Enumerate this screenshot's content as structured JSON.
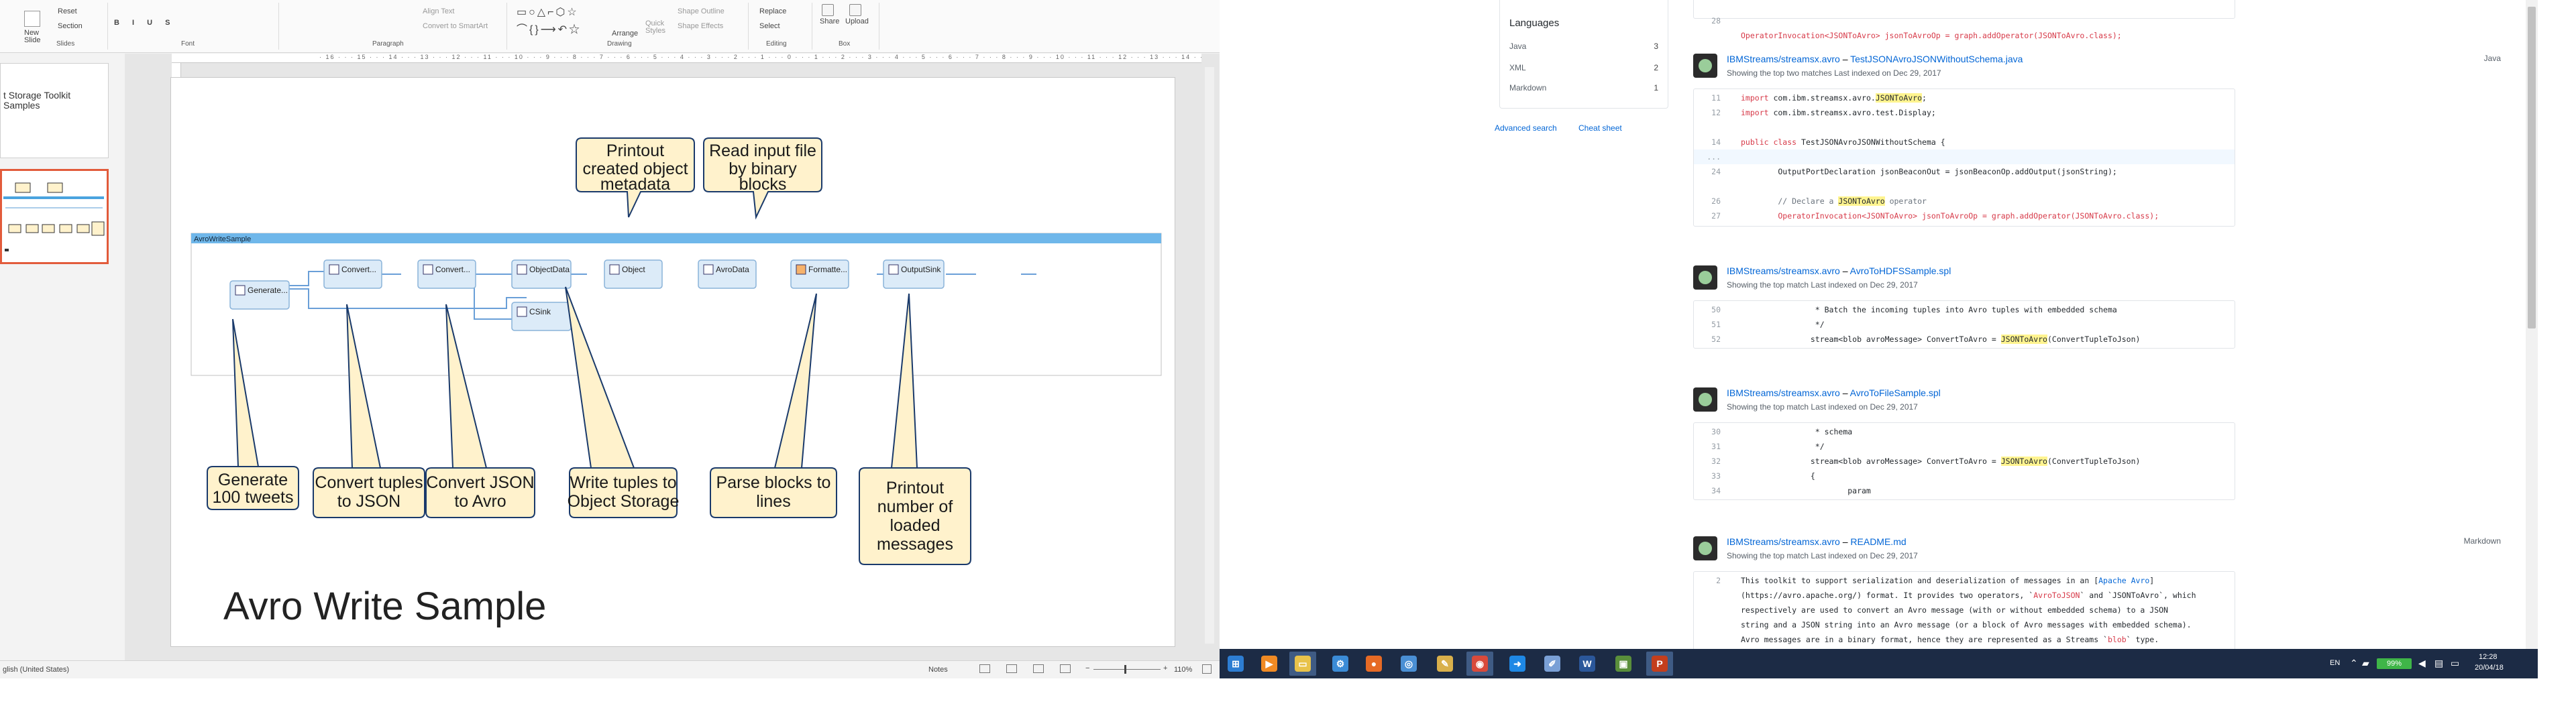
{
  "ppt": {
    "ribbon": {
      "new_slide": "New\nSlide",
      "reset": "Reset",
      "section": "Section",
      "align_text": "Align Text",
      "convert_smartart": "Convert to SmartArt",
      "arrange": "Arrange",
      "quick_styles": "Quick\nStyles",
      "shape_outline": "Shape Outline",
      "shape_effects": "Shape Effects",
      "replace": "Replace",
      "select": "Select",
      "share": "Share",
      "upload": "Upload",
      "group_slides": "Slides",
      "group_font": "Font",
      "group_paragraph": "Paragraph",
      "group_drawing": "Drawing",
      "group_editing": "Editing",
      "group_box": "Box"
    },
    "thumbnails": [
      {
        "text": "t Storage Toolkit\nSamples"
      }
    ],
    "ruler_text": "· 16 · · · 15 · · · 14 · · · 13 · · · 12 · · · 11 · · · 10 · · · 9 · · · 8 · · · 7 · · · 6 · · · 5 · · · 4 · · · 3 · · · 2 · · · 1 · · · 0 · · · 1 · · · 2 · · · 3 · · · 4 · · · 5 · · · 6 · · · 7 · · · 8 · · · 9 · · · 10 · · · 11 · · · 12 · · · 13 · · · 14 · · · 15 · · · 16 ·",
    "slide": {
      "title": "Avro Write Sample",
      "graph_header": "AvroWriteSample",
      "nodes": [
        "Generate...",
        "Convert...",
        "Convert...",
        "ObjectData",
        "Object",
        "AvroData",
        "Formatte...",
        "OutputSink",
        "CSink"
      ],
      "callouts": {
        "printout_metadata": [
          "Printout",
          "created object",
          "metadata"
        ],
        "read_input": [
          "Read input file",
          "by binary",
          "blocks"
        ],
        "generate": [
          "Generate",
          "100 tweets"
        ],
        "convert_json": [
          "Convert tuples",
          "to JSON"
        ],
        "convert_avro": [
          "Convert JSON",
          "to Avro"
        ],
        "write_tuples": [
          "Write tuples to",
          "Object Storage"
        ],
        "parse_blocks": [
          "Parse blocks to",
          "lines"
        ],
        "printout_count": [
          "Printout",
          "number of",
          "loaded",
          "messages"
        ]
      }
    },
    "status": {
      "language": "glish (United States)",
      "notes": "Notes",
      "zoom": "110%"
    }
  },
  "github": {
    "languages": {
      "heading": "Languages",
      "items": [
        {
          "name": "Java",
          "count": "3"
        },
        {
          "name": "XML",
          "count": "2"
        },
        {
          "name": "Markdown",
          "count": "1"
        }
      ]
    },
    "advanced_search": "Advanced search",
    "cheat_sheet": "Cheat sheet",
    "top_snippet": {
      "ln": "28",
      "pre": "OperatorInvocation<JSONToAvro> jsonToAvroOp = graph.addOperator(JSONToAvro.class);"
    },
    "results": [
      {
        "repo": "IBMStreams/streamsx.avro",
        "sep": " – ",
        "file": "TestJSONAvroJSONWithoutSchema.java",
        "meta": "Showing the top two matches    Last indexed on Dec 29, 2017",
        "lang": "Java",
        "lines": [
          {
            "ln": "11",
            "kw": "import",
            "pre": " com.ibm.streamsx.avro.",
            "hl": "JSONToAvro",
            "post": ";"
          },
          {
            "ln": "12",
            "kw": "import",
            "pre": " com.ibm.streamsx.avro.test.Display;",
            "hl": "",
            "post": ""
          },
          {
            "ln": "",
            "kw": "",
            "pre": "",
            "hl": "",
            "post": ""
          },
          {
            "ln": "14",
            "kw": "public class",
            "pre": " TestJSONAvroJSONWithoutSchema {",
            "hl": "",
            "post": ""
          },
          {
            "ln": "...",
            "kw": "",
            "pre": "",
            "hl": "",
            "post": ""
          },
          {
            "ln": "24",
            "kw": "",
            "pre": "        OutputPortDeclaration jsonBeaconOut = jsonBeaconOp.addOutput(jsonString);",
            "hl": "",
            "post": ""
          },
          {
            "ln": "",
            "kw": "",
            "pre": "",
            "hl": "",
            "post": ""
          },
          {
            "ln": "26",
            "kw": "",
            "pre": "        // Declare a ",
            "hl": "JSONToAvro",
            "post": " operator"
          },
          {
            "ln": "27",
            "kw": "",
            "pre": "        OperatorInvocation<JSONToAvro> jsonToAvroOp = graph.addOperator(JSONToAvro.class);",
            "hl": "",
            "post": ""
          }
        ]
      },
      {
        "repo": "IBMStreams/streamsx.avro",
        "sep": " – ",
        "file": "AvroToHDFSSample.spl",
        "meta": "Showing the top match    Last indexed on Dec 29, 2017",
        "lang": "",
        "lines": [
          {
            "ln": "50",
            "kw": "",
            "pre": "                * Batch the incoming tuples into Avro tuples with embedded schema",
            "hl": "",
            "post": ""
          },
          {
            "ln": "51",
            "kw": "",
            "pre": "                */",
            "hl": "",
            "post": ""
          },
          {
            "ln": "52",
            "kw": "",
            "pre": "               stream<blob avroMessage> ConvertToAvro = ",
            "hl": "JSONToAvro",
            "post": "(ConvertTupleToJson)"
          }
        ]
      },
      {
        "repo": "IBMStreams/streamsx.avro",
        "sep": " – ",
        "file": "AvroToFileSample.spl",
        "meta": "Showing the top match    Last indexed on Dec 29, 2017",
        "lang": "",
        "lines": [
          {
            "ln": "30",
            "kw": "",
            "pre": "                * schema",
            "hl": "",
            "post": ""
          },
          {
            "ln": "31",
            "kw": "",
            "pre": "                */",
            "hl": "",
            "post": ""
          },
          {
            "ln": "32",
            "kw": "",
            "pre": "               stream<blob avroMessage> ConvertToAvro = ",
            "hl": "JSONToAvro",
            "post": "(ConvertTupleToJson)"
          },
          {
            "ln": "33",
            "kw": "",
            "pre": "               {",
            "hl": "",
            "post": ""
          },
          {
            "ln": "34",
            "kw": "",
            "pre": "                       param",
            "hl": "",
            "post": ""
          }
        ]
      },
      {
        "repo": "IBMStreams/streamsx.avro",
        "sep": " – ",
        "file": "README.md",
        "meta": "Showing the top match    Last indexed on Dec 29, 2017",
        "lang": "Markdown",
        "readme": [
          {
            "ln": "2",
            "a": "This toolkit to support serialization and deserialization of messages in an [",
            "b": "Apache Avro",
            "c": "]"
          },
          {
            "ln": "",
            "a": "(https://avro.apache.org/) format. It provides two operators, `",
            "b": "AvroToJSON",
            "c": "` and `JSONToAvro`, which"
          },
          {
            "ln": "",
            "a": "respectively are used to convert an Avro message (with or without embedded schema) to a JSON",
            "b": "",
            "c": ""
          },
          {
            "ln": "",
            "a": "string and a JSON string into an Avro message (or a block of Avro messages with embedded schema).",
            "b": "",
            "c": ""
          },
          {
            "ln": "",
            "a": "Avro messages are in a binary format, hence they are represented as a Streams `",
            "b": "blob",
            "c": "` type."
          }
        ]
      }
    ]
  },
  "taskbar": {
    "apps": [
      {
        "name": "start",
        "glyph": "⊞",
        "color": "#2d7dd2"
      },
      {
        "name": "media",
        "glyph": "▶",
        "color": "#f08a24"
      },
      {
        "name": "explorer",
        "glyph": "▭",
        "color": "#e8c24a"
      },
      {
        "name": "teams",
        "glyph": "⚙",
        "color": "#3b8bd6"
      },
      {
        "name": "firefox",
        "glyph": "●",
        "color": "#e66a25"
      },
      {
        "name": "network",
        "glyph": "◎",
        "color": "#4a8fd4"
      },
      {
        "name": "tool",
        "glyph": "✎",
        "color": "#d9b04b"
      },
      {
        "name": "chrome",
        "glyph": "◉",
        "color": "#d94a3b"
      },
      {
        "name": "arrow",
        "glyph": "➜",
        "color": "#1e88e5"
      },
      {
        "name": "pen",
        "glyph": "✐",
        "color": "#7aa0d6"
      },
      {
        "name": "word",
        "glyph": "W",
        "color": "#2b579a"
      },
      {
        "name": "app",
        "glyph": "▣",
        "color": "#5a8f3b"
      },
      {
        "name": "powerpoint",
        "glyph": "P",
        "color": "#c43e1c"
      }
    ],
    "tray": {
      "lang": "EN",
      "battery": "99%",
      "time": "12:28",
      "date": "20/04/18"
    }
  }
}
